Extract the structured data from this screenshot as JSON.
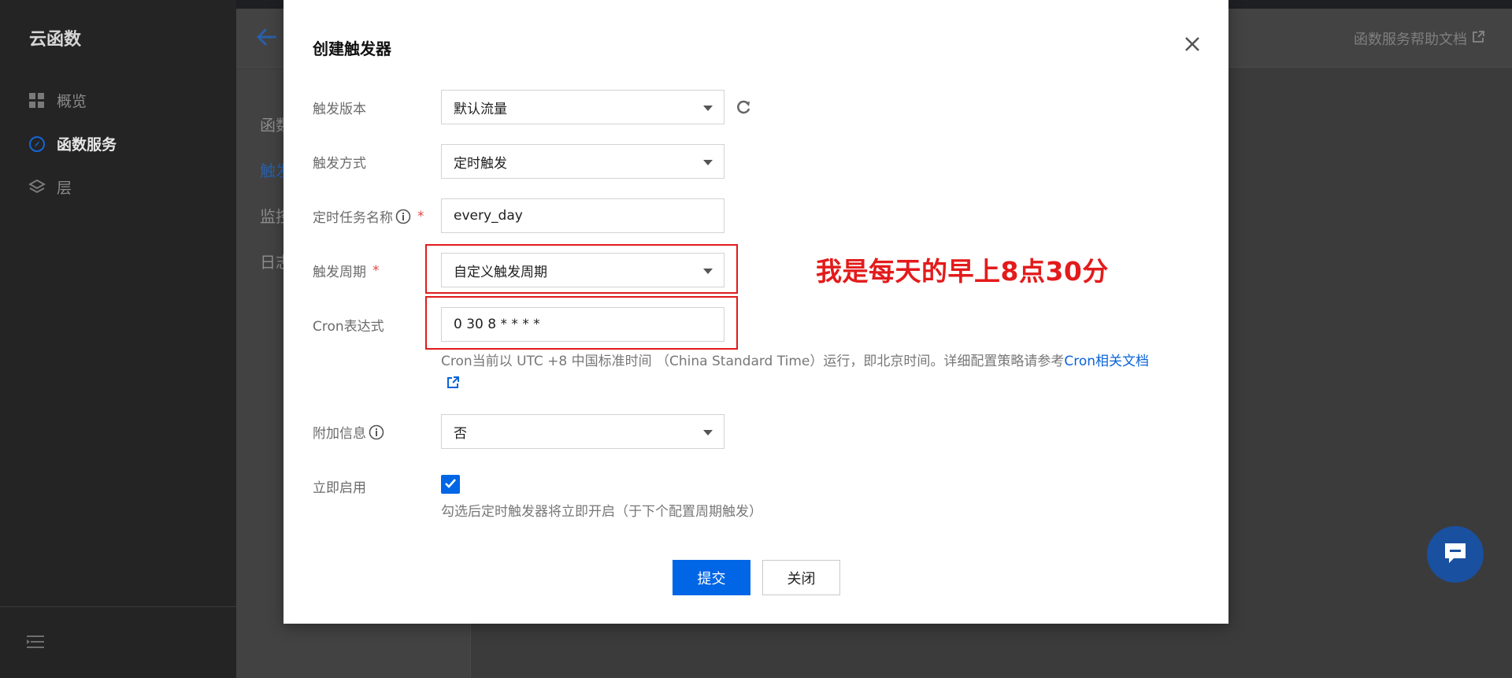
{
  "app": {
    "brand": "云函数",
    "help_link": "函数服务帮助文档"
  },
  "sidebar": {
    "items": [
      {
        "label": "概览",
        "icon": "grid-icon"
      },
      {
        "label": "函数服务",
        "icon": "compass-icon"
      },
      {
        "label": "层",
        "icon": "layers-icon"
      }
    ]
  },
  "subnav": {
    "items": [
      {
        "label": "函数"
      },
      {
        "label": "触发"
      },
      {
        "label": "监控"
      },
      {
        "label": "日志"
      }
    ]
  },
  "modal": {
    "title": "创建触发器",
    "fields": {
      "version": {
        "label": "触发版本",
        "value": "默认流量"
      },
      "method": {
        "label": "触发方式",
        "value": "定时触发"
      },
      "task_name": {
        "label": "定时任务名称",
        "value": "every_day"
      },
      "period": {
        "label": "触发周期",
        "value": "自定义触发周期"
      },
      "cron": {
        "label": "Cron表达式",
        "value": "0 30 8 * * * *"
      },
      "extra": {
        "label": "附加信息",
        "value": "否"
      },
      "enable": {
        "label": "立即启用",
        "checked": true
      }
    },
    "cron_help": "Cron当前以 UTC +8 中国标准时间 （China Standard Time）运行，即北京时间。详细配置策略请参考",
    "cron_help_link": "Cron相关文档",
    "enable_help": "勾选后定时触发器将立即开启（于下个配置周期触发）",
    "submit_label": "提交",
    "close_label": "关闭"
  },
  "annotation": {
    "text": "我是每天的早上8点30分",
    "color": "#e31b1b"
  },
  "colors": {
    "primary": "#0066e6",
    "link": "#0a63d8"
  }
}
